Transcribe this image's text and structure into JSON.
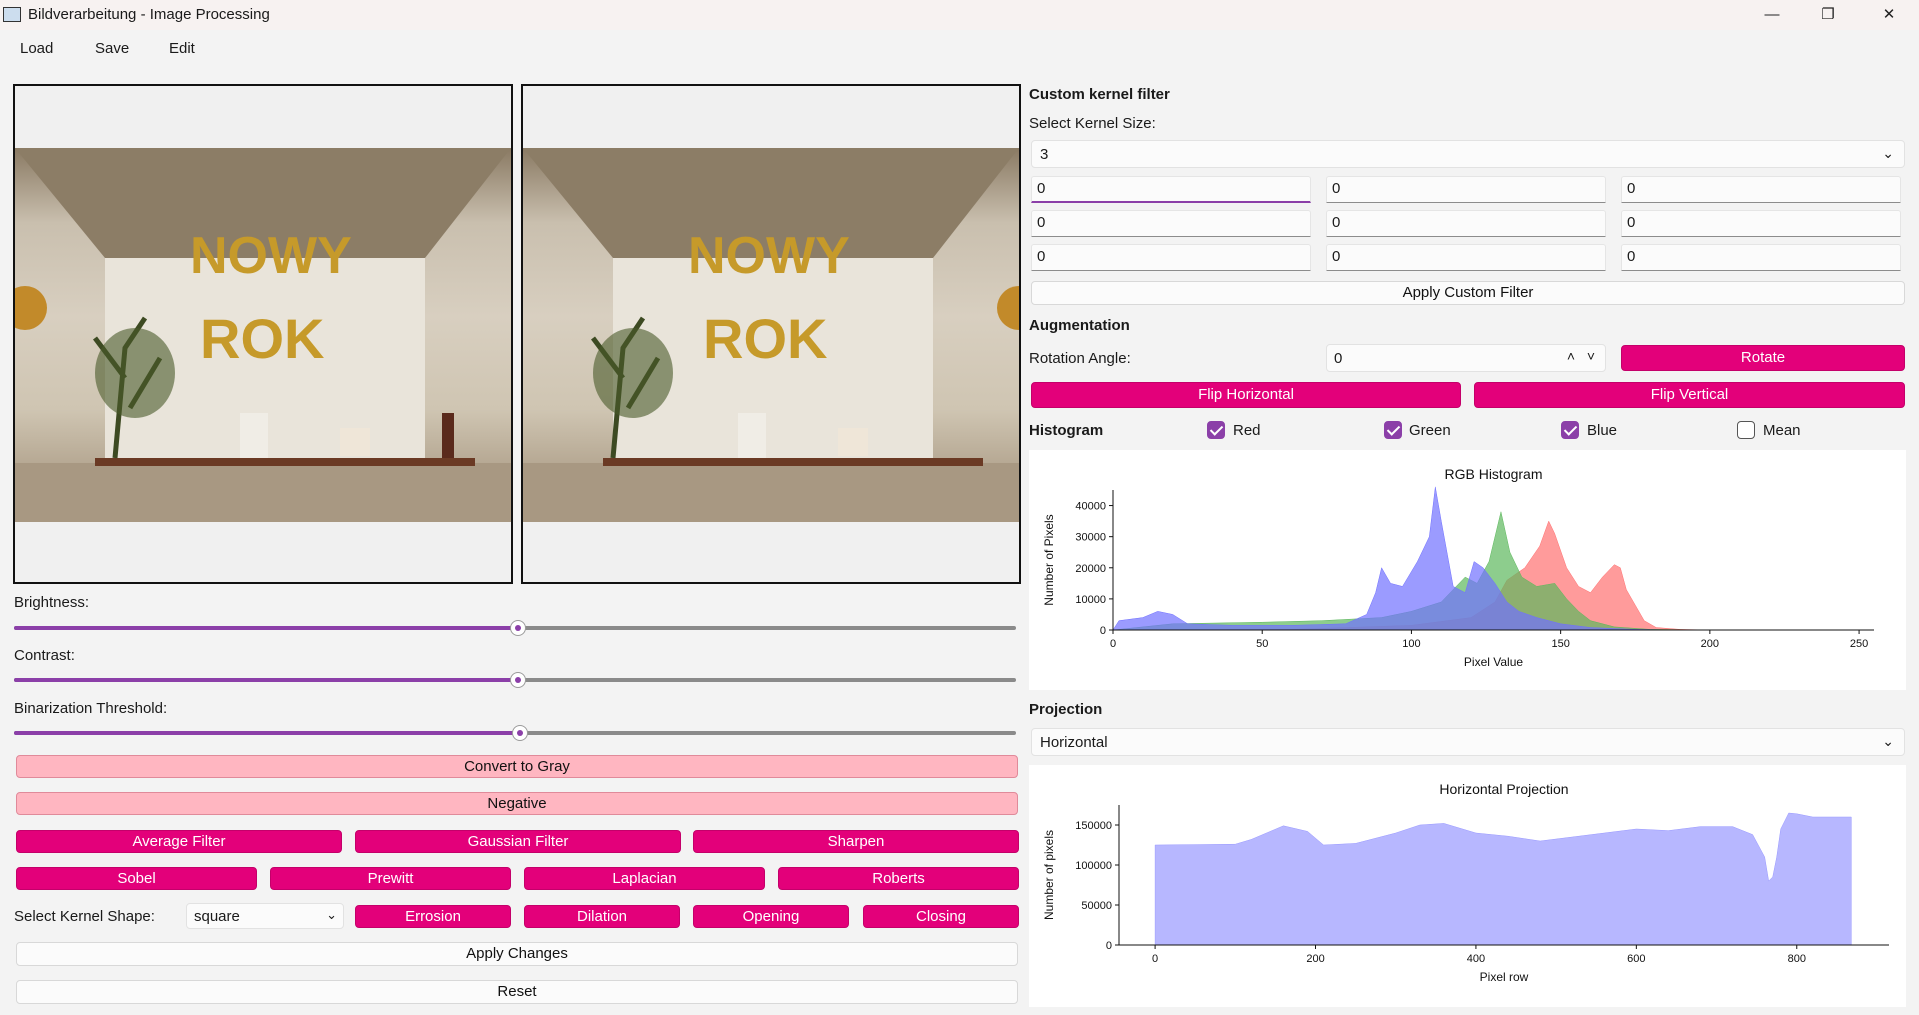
{
  "window": {
    "title": "Bildverarbeitung - Image Processing",
    "controls": {
      "minimize": "—",
      "maximize": "❐",
      "close": "✕"
    }
  },
  "menu": {
    "load": "Load",
    "save": "Save",
    "edit": "Edit"
  },
  "left": {
    "brightness_label": "Brightness:",
    "contrast_label": "Contrast:",
    "threshold_label": "Binarization Threshold:",
    "brightness_value": 0.5,
    "contrast_value": 0.5,
    "threshold_value": 0.5,
    "convert_gray": "Convert to Gray",
    "negative": "Negative",
    "average_filter": "Average Filter",
    "gaussian_filter": "Gaussian Filter",
    "sharpen": "Sharpen",
    "sobel": "Sobel",
    "prewitt": "Prewitt",
    "laplacian": "Laplacian",
    "roberts": "Roberts",
    "kernel_shape_label": "Select Kernel Shape:",
    "kernel_shape_value": "square",
    "erosion": "Errosion",
    "dilation": "Dilation",
    "opening": "Opening",
    "closing": "Closing",
    "apply_changes": "Apply Changes",
    "reset": "Reset",
    "photo_text_line1": "NOWY",
    "photo_text_line2": "ROK"
  },
  "right": {
    "custom_kernel_title": "Custom kernel filter",
    "kernel_size_label": "Select Kernel Size:",
    "kernel_size_value": "3",
    "kernel": [
      [
        "0",
        "0",
        "0"
      ],
      [
        "0",
        "0",
        "0"
      ],
      [
        "0",
        "0",
        "0"
      ]
    ],
    "apply_custom": "Apply Custom Filter",
    "augmentation_title": "Augmentation",
    "rotation_label": "Rotation Angle:",
    "rotation_value": "0",
    "rotate": "Rotate",
    "flip_h": "Flip Horizontal",
    "flip_v": "Flip Vertical",
    "histogram_title": "Histogram",
    "chk_red": "Red",
    "chk_green": "Green",
    "chk_blue": "Blue",
    "chk_mean": "Mean",
    "projection_title": "Projection",
    "projection_value": "Horizontal"
  },
  "colors": {
    "accent": "#8b3fa8",
    "magenta": "#e3007a",
    "light_pink": "#ffb6c1",
    "hist_red": "#ff7070",
    "hist_green": "#5cb85c",
    "hist_blue": "#7070ff"
  },
  "chart_data": [
    {
      "type": "area",
      "title": "RGB Histogram",
      "xlabel": "Pixel Value",
      "ylabel": "Number of Pixels",
      "xlim": [
        0,
        255
      ],
      "ylim": [
        0,
        45000
      ],
      "x_ticks": [
        "0",
        "50",
        "100",
        "150",
        "200",
        "250"
      ],
      "y_ticks": [
        "0",
        "10000",
        "20000",
        "30000",
        "40000"
      ],
      "series": [
        {
          "name": "Red",
          "color": "#ff7070",
          "points": [
            [
              0,
              0
            ],
            [
              60,
              200
            ],
            [
              100,
              1500
            ],
            [
              120,
              4000
            ],
            [
              128,
              9000
            ],
            [
              132,
              16000
            ],
            [
              138,
              20000
            ],
            [
              143,
              27000
            ],
            [
              146,
              35000
            ],
            [
              148,
              31000
            ],
            [
              152,
              20000
            ],
            [
              156,
              14000
            ],
            [
              160,
              12000
            ],
            [
              164,
              17000
            ],
            [
              168,
              21000
            ],
            [
              170,
              20000
            ],
            [
              172,
              13000
            ],
            [
              175,
              8000
            ],
            [
              178,
              3000
            ],
            [
              182,
              800
            ],
            [
              190,
              200
            ],
            [
              200,
              0
            ]
          ]
        },
        {
          "name": "Green",
          "color": "#5cb85c",
          "points": [
            [
              0,
              0
            ],
            [
              20,
              2000
            ],
            [
              50,
              2500
            ],
            [
              70,
              3000
            ],
            [
              80,
              3500
            ],
            [
              90,
              4000
            ],
            [
              100,
              6000
            ],
            [
              110,
              9000
            ],
            [
              115,
              14000
            ],
            [
              118,
              17000
            ],
            [
              122,
              15000
            ],
            [
              126,
              22000
            ],
            [
              130,
              38000
            ],
            [
              133,
              25000
            ],
            [
              137,
              17000
            ],
            [
              142,
              14000
            ],
            [
              148,
              15000
            ],
            [
              152,
              10000
            ],
            [
              156,
              6000
            ],
            [
              160,
              3000
            ],
            [
              168,
              1000
            ],
            [
              180,
              200
            ],
            [
              200,
              0
            ]
          ]
        },
        {
          "name": "Blue",
          "color": "#7070ff",
          "points": [
            [
              0,
              0
            ],
            [
              2,
              3000
            ],
            [
              10,
              4000
            ],
            [
              15,
              6000
            ],
            [
              20,
              5000
            ],
            [
              25,
              2000
            ],
            [
              40,
              1500
            ],
            [
              60,
              1500
            ],
            [
              78,
              2000
            ],
            [
              85,
              5000
            ],
            [
              88,
              12000
            ],
            [
              90,
              20000
            ],
            [
              93,
              15000
            ],
            [
              97,
              14000
            ],
            [
              102,
              22000
            ],
            [
              106,
              30000
            ],
            [
              108,
              46000
            ],
            [
              110,
              35000
            ],
            [
              114,
              14000
            ],
            [
              118,
              12000
            ],
            [
              121,
              22000
            ],
            [
              124,
              20000
            ],
            [
              128,
              15000
            ],
            [
              132,
              9000
            ],
            [
              136,
              6000
            ],
            [
              142,
              4000
            ],
            [
              150,
              2000
            ],
            [
              160,
              800
            ],
            [
              175,
              200
            ],
            [
              190,
              0
            ]
          ]
        }
      ]
    },
    {
      "type": "area",
      "title": "Horizontal Projection",
      "xlabel": "Pixel row",
      "ylabel": "Number of pixels",
      "xlim": [
        -45,
        915
      ],
      "ylim": [
        0,
        175000
      ],
      "x_ticks": [
        "0",
        "200",
        "400",
        "600",
        "800"
      ],
      "y_ticks": [
        "0",
        "50000",
        "100000",
        "150000"
      ],
      "series": [
        {
          "name": "",
          "color": "#9999ff",
          "points": [
            [
              0,
              125000
            ],
            [
              100,
              126000
            ],
            [
              120,
              132000
            ],
            [
              160,
              149000
            ],
            [
              190,
              142000
            ],
            [
              210,
              125000
            ],
            [
              250,
              127000
            ],
            [
              300,
              140000
            ],
            [
              330,
              150000
            ],
            [
              360,
              152000
            ],
            [
              400,
              140000
            ],
            [
              440,
              136000
            ],
            [
              480,
              130000
            ],
            [
              520,
              135000
            ],
            [
              560,
              140000
            ],
            [
              600,
              145000
            ],
            [
              640,
              143000
            ],
            [
              680,
              148000
            ],
            [
              720,
              148000
            ],
            [
              745,
              138000
            ],
            [
              760,
              110000
            ],
            [
              765,
              80000
            ],
            [
              770,
              85000
            ],
            [
              775,
              110000
            ],
            [
              780,
              145000
            ],
            [
              785,
              155000
            ],
            [
              790,
              165000
            ],
            [
              800,
              164000
            ],
            [
              820,
              160000
            ],
            [
              868,
              160000
            ]
          ]
        }
      ]
    }
  ]
}
